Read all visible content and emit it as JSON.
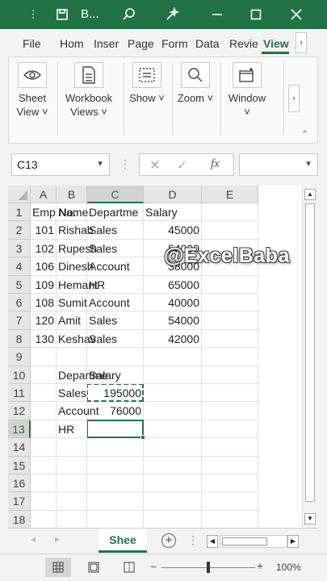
{
  "titlebar": {
    "doc_title": "B...",
    "bg_color": "#217346"
  },
  "tabs": [
    {
      "label": "File"
    },
    {
      "label": "Hom"
    },
    {
      "label": "Inser"
    },
    {
      "label": "Page"
    },
    {
      "label": "Form"
    },
    {
      "label": "Data"
    },
    {
      "label": "Revie"
    },
    {
      "label": "View",
      "active": true
    }
  ],
  "ribbon": {
    "sheet_view": "Sheet View ˅",
    "workbook_views": "Workbook Views ˅",
    "show": "Show ˅",
    "zoom": "Zoom ˅",
    "window": "Window ˅"
  },
  "formula_bar": {
    "name_box": "C13",
    "fx": "fx",
    "formula": ""
  },
  "grid": {
    "columns": [
      "A",
      "B",
      "C",
      "D",
      "E"
    ],
    "selected_column": "C",
    "selected_row": 13,
    "rows": [
      {
        "r": 1,
        "A": "Emp No.",
        "B": "Name",
        "C": "Departme",
        "D": "Salary"
      },
      {
        "r": 2,
        "A": "101",
        "B": "Rishab",
        "C": "Sales",
        "D": "45000"
      },
      {
        "r": 3,
        "A": "102",
        "B": "Rupesh",
        "C": "Sales",
        "D": "54000"
      },
      {
        "r": 4,
        "A": "106",
        "B": "Dinesh",
        "C": "Account",
        "D": "38000"
      },
      {
        "r": 5,
        "A": "109",
        "B": "Hemant",
        "C": "HR",
        "D": "65000"
      },
      {
        "r": 6,
        "A": "108",
        "B": "Sumit",
        "C": "Account",
        "D": "40000"
      },
      {
        "r": 7,
        "A": "120",
        "B": "Amit",
        "C": "Sales",
        "D": "54000"
      },
      {
        "r": 8,
        "A": "130",
        "B": "Keshav",
        "C": "Sales",
        "D": "42000"
      },
      {
        "r": 9
      },
      {
        "r": 10,
        "B": "Departme",
        "C": "Salary"
      },
      {
        "r": 11,
        "B": "Sales",
        "C": "195000"
      },
      {
        "r": 12,
        "B": "Account",
        "C": "76000"
      },
      {
        "r": 13,
        "B": "HR"
      },
      {
        "r": 14
      },
      {
        "r": 15
      },
      {
        "r": 16
      },
      {
        "r": 17
      },
      {
        "r": 18
      }
    ]
  },
  "watermark": "@ExcelBaba",
  "sheet_tab": "Shee",
  "status": {
    "zoom": "100%"
  },
  "accent_color": "#217346"
}
